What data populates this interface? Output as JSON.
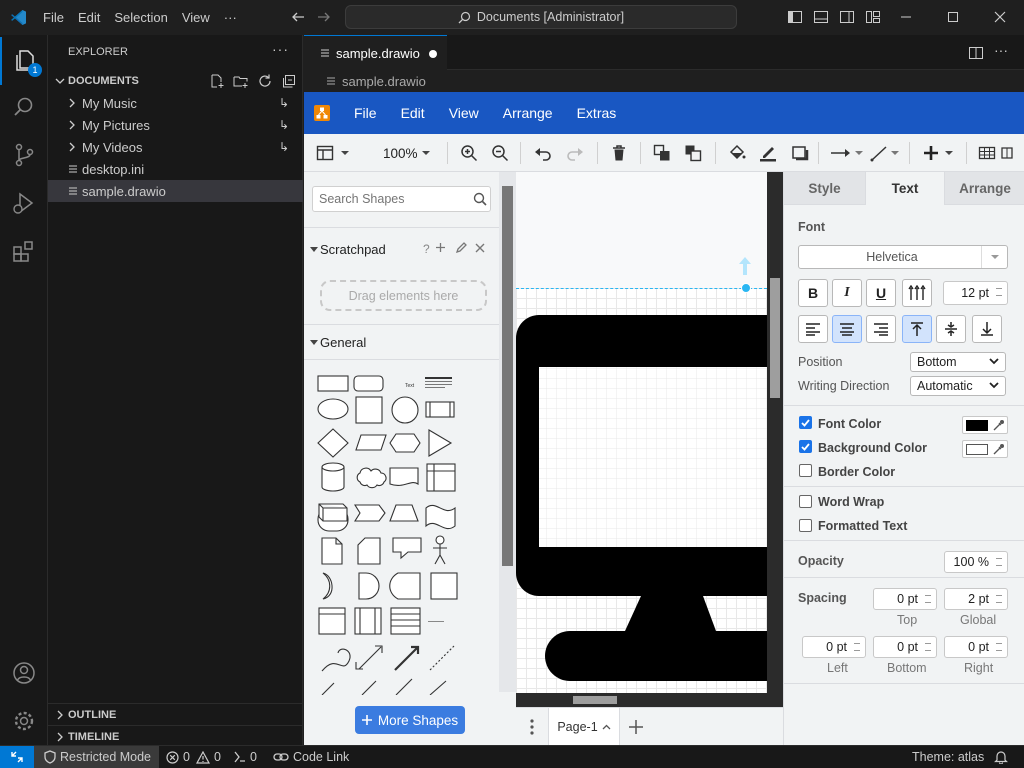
{
  "titlebar": {
    "menus": [
      "File",
      "Edit",
      "Selection",
      "View",
      "···"
    ],
    "command_center": "Documents [Administrator]"
  },
  "activity": {
    "explorer_badge": "1"
  },
  "explorer": {
    "header": "EXPLORER",
    "section": "DOCUMENTS",
    "items": [
      {
        "label": "My Music",
        "type": "folder"
      },
      {
        "label": "My Pictures",
        "type": "folder"
      },
      {
        "label": "My Videos",
        "type": "folder"
      },
      {
        "label": "desktop.ini",
        "type": "file"
      },
      {
        "label": "sample.drawio",
        "type": "file",
        "selected": true
      }
    ],
    "outline": "OUTLINE",
    "timeline": "TIMELINE"
  },
  "editor": {
    "tab_label": "sample.drawio",
    "breadcrumb": "sample.drawio"
  },
  "drawio": {
    "menus": [
      "File",
      "Edit",
      "View",
      "Arrange",
      "Extras"
    ],
    "zoom": "100%",
    "search_placeholder": "Search Shapes",
    "scratchpad": {
      "title": "Scratchpad",
      "hint": "Drag elements here"
    },
    "general": "General",
    "more_shapes": "More Shapes",
    "page_tab": "Page-1",
    "format": {
      "tabs": [
        "Style",
        "Text",
        "Arrange"
      ],
      "active_tab": "Text",
      "font_label": "Font",
      "font_name": "Helvetica",
      "font_size": "12 pt",
      "bold": "B",
      "italic": "I",
      "underline": "U",
      "position_label": "Position",
      "position_value": "Bottom",
      "writing_direction_label": "Writing Direction",
      "writing_direction_value": "Automatic",
      "font_color": "Font Color",
      "background_color": "Background Color",
      "border_color": "Border Color",
      "word_wrap": "Word Wrap",
      "formatted_text": "Formatted Text",
      "opacity_label": "Opacity",
      "opacity_value": "100 %",
      "spacing_label": "Spacing",
      "spacing": {
        "top": "0 pt",
        "global": "2 pt",
        "left": "0 pt",
        "bottom": "0 pt",
        "right": "0 pt",
        "top_label": "Top",
        "global_label": "Global",
        "left_label": "Left",
        "bottom_label": "Bottom",
        "right_label": "Right"
      }
    }
  },
  "statusbar": {
    "restricted": "Restricted Mode",
    "errors": "0",
    "warnings": "0",
    "ports": "0",
    "code_link": "Code Link",
    "theme": "Theme: atlas"
  },
  "colors": {
    "accent": "#0078d4",
    "drawio_blue": "#1957c2",
    "selection": "#37373d"
  }
}
